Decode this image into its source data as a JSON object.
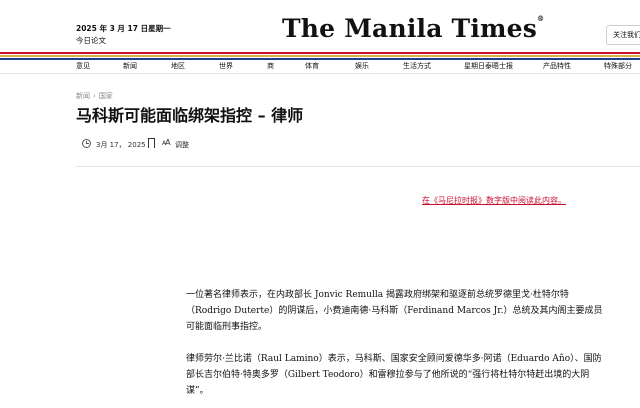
{
  "header": {
    "date": "2025 年 3 月 17 日星期一",
    "today_label": "今日论文",
    "logo": "The Manila Times",
    "logo_mark": "®",
    "follow_label": "关注我们"
  },
  "colors": {
    "stripe_red": "#c8102e",
    "stripe_gold": "#d6b24c",
    "stripe_blue": "#1f3e8a",
    "link_red": "#c8102e"
  },
  "nav": {
    "items": [
      "意见",
      "新闻",
      "地区",
      "世界",
      "商",
      "体育",
      "娱乐",
      "生活方式",
      "星期日泰晤士报",
      "产品特性",
      "特殊部分"
    ]
  },
  "article": {
    "breadcrumb": [
      "新闻",
      "国家"
    ],
    "breadcrumb_separator": "›",
    "title": "马科斯可能面临绑架指控 – 律师",
    "published": "3月 17， 2025",
    "font_size_icon": "A",
    "font_size_icon_small": "A",
    "adjust_label": "调整",
    "digital_edition_link": "在《马尼拉时报》数字版中阅读此内容。",
    "paragraphs": [
      "一位著名律师表示，在内政部长 Jonvic Remulla 揭露政府绑架和驱逐前总统罗德里戈·杜特尔特（Rodrigo Duterte）的阴谋后，小费迪南德·马科斯（Ferdinand Marcos Jr.）总统及其内阁主要成员可能面临刑事指控。",
      "律师劳尔·兰比诺（Raul Lamino）表示，马科斯、国家安全顾问爱德华多·阿诺（Eduardo Año）、国防部长吉尔伯特·特奥多罗（Gilbert Teodoro）和雷穆拉参与了他所说的“强行将杜特尔特赶出境的大阴谋”。"
    ]
  },
  "icons": {
    "clock": "clock-icon",
    "bookmark": "bookmark-icon",
    "font_size": "font-size-icon"
  }
}
